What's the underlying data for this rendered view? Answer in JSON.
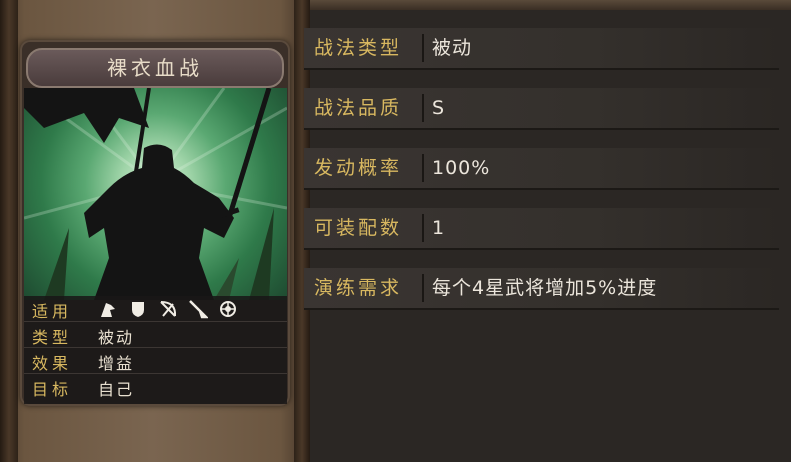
{
  "skill_card": {
    "name": "裸衣血战",
    "stats": [
      {
        "key": "适用",
        "value": ""
      },
      {
        "key": "类型",
        "value": "被动"
      },
      {
        "key": "效果",
        "value": "增益"
      },
      {
        "key": "目标",
        "value": "自己"
      }
    ],
    "applicable_icons": [
      "cavalry-icon",
      "shield-icon",
      "bow-icon",
      "spear-icon",
      "siege-icon"
    ]
  },
  "details": [
    {
      "label": "战法类型",
      "value": "被动"
    },
    {
      "label": "战法品质",
      "value": "S"
    },
    {
      "label": "发动概率",
      "value": "100%"
    },
    {
      "label": "可装配数",
      "value": "1"
    },
    {
      "label": "演练需求",
      "value": "每个4星武将增加5%进度"
    }
  ],
  "colors": {
    "label_gold": "#d8b860",
    "value_text": "#ece6dc",
    "art_green": "#5aa872"
  }
}
